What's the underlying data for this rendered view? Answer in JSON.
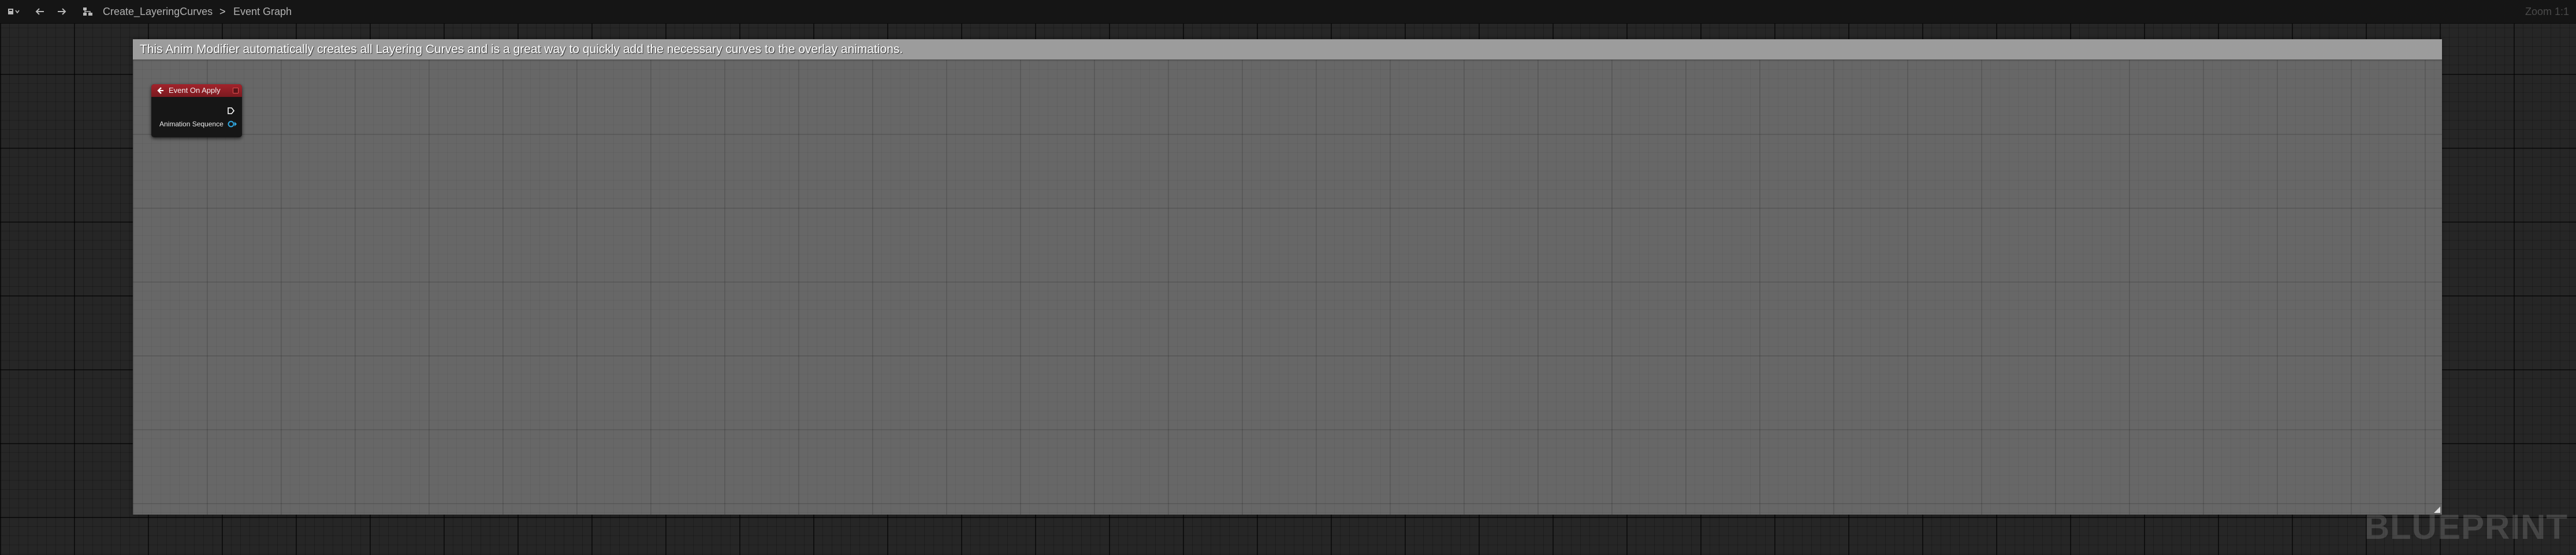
{
  "topbar": {
    "icons": {
      "blueprint_menu": "blueprint-icon",
      "back": "arrow-left-icon",
      "forward": "arrow-right-icon",
      "graph_tree": "graph-tree-icon"
    },
    "breadcrumb": {
      "asset": "Create_LayeringCurves",
      "separator": ">",
      "graph": "Event Graph"
    },
    "zoom": "Zoom 1:1"
  },
  "comment": {
    "text": "This Anim Modifier automatically creates all Layering Curves and is a great way to quickly add the necessary curves to the overlay animations."
  },
  "event_node": {
    "title": "Event On Apply",
    "output_pin_label": "Animation Sequence",
    "header_color": "#a3232b",
    "pin_color": "#2fa7e0"
  },
  "watermark": "BLUEPRINT"
}
